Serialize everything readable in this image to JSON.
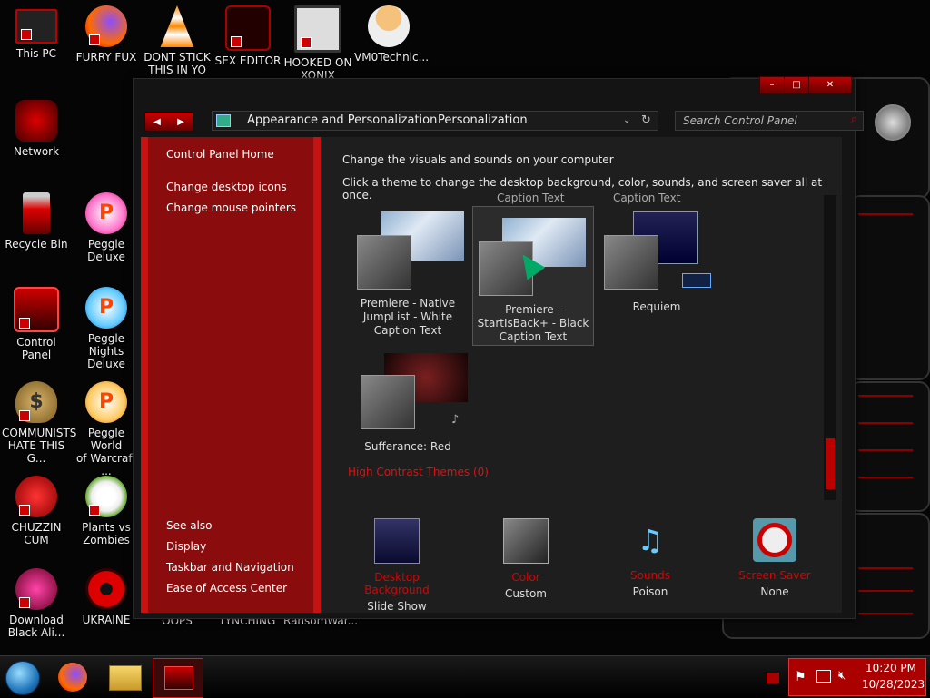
{
  "desktop_icons": [
    {
      "label": "This PC",
      "glyph": "monitor-icon",
      "color": "#b00000"
    },
    {
      "label": "FURRY FUX",
      "glyph": "firefox-icon",
      "color": "#e66000"
    },
    {
      "label": "DONT STICK\nTHIS IN YO",
      "glyph": "vlc-cone-icon",
      "color": "#ff8800"
    },
    {
      "label": "SEX EDITOR",
      "glyph": "editor-icon",
      "color": "#400"
    },
    {
      "label": "HOOKED ON\nXONIX",
      "glyph": "maze-icon",
      "color": "#ddd"
    },
    {
      "label": "VM0Technic...",
      "glyph": "doctor-icon",
      "color": "#f4c27a"
    },
    {
      "label": "Network",
      "glyph": "network-icon",
      "color": "#b00000"
    },
    {
      "label": "Recycle Bin",
      "glyph": "recycle-bin-icon",
      "color": "#cc0000"
    },
    {
      "label": "Peggle Deluxe",
      "glyph": "peggle-icon",
      "color": "#ffb000"
    },
    {
      "label": "Control Panel",
      "glyph": "control-panel-icon",
      "color": "#900"
    },
    {
      "label": "Peggle Nights\nDeluxe",
      "glyph": "peggle-icon",
      "color": "#ffb000"
    },
    {
      "label": "COMMUNISTS\nHATE THIS G...",
      "glyph": "money-bag-icon",
      "color": "#b8934a"
    },
    {
      "label": "Peggle World\nof Warcraft ...",
      "glyph": "peggle-icon",
      "color": "#ffb000"
    },
    {
      "label": "CHUZZIN\nCUM",
      "glyph": "chuzzle-icon",
      "color": "#cc0000"
    },
    {
      "label": "Plants vs\nZombies",
      "glyph": "flower-icon",
      "color": "#e8e8e8"
    },
    {
      "label": "Download\nBlack Ali...",
      "glyph": "alien-sphere-icon",
      "color": "#c02040"
    },
    {
      "label": "UKRAINE",
      "glyph": "radiation-icon",
      "color": "#cc0000"
    },
    {
      "label": "OOPS",
      "glyph": "",
      "color": ""
    },
    {
      "label": "LYNCHING",
      "glyph": "",
      "color": ""
    },
    {
      "label": "RansomWar...",
      "glyph": "",
      "color": ""
    }
  ],
  "window": {
    "nav": {
      "back_symbol": "◀",
      "forward_symbol": "▶",
      "breadcrumb_1": "Appearance and Personalization",
      "breadcrumb_2": "Personalization",
      "search_placeholder": "Search Control Panel"
    },
    "caption_buttons": {
      "minimize": "–",
      "maximize": "□",
      "close": "✕"
    },
    "sidebar": {
      "home": "Control Panel Home",
      "link1": "Change desktop icons",
      "link2": "Change mouse pointers",
      "see_also": "See also",
      "see1": "Display",
      "see2": "Taskbar and Navigation",
      "see3": "Ease of Access Center"
    },
    "main": {
      "heading": "Change the visuals and sounds on your computer",
      "subheading": "Click a theme to change the desktop background, color, sounds, and screen saver all at once.",
      "cutoff_caption_1": "Caption Text",
      "cutoff_caption_2": "Caption Text",
      "themes": [
        {
          "name": "Premiere - Native\nJumpList - White\nCaption Text"
        },
        {
          "name": "Premiere -\nStartIsBack+ - Black\nCaption Text"
        },
        {
          "name": "Requiem"
        },
        {
          "name": "Sufferance: Red"
        }
      ],
      "high_contrast": "High Contrast Themes (0)",
      "bottom": [
        {
          "label": "Desktop Background",
          "value": "Slide Show"
        },
        {
          "label": "Color",
          "value": "Custom"
        },
        {
          "label": "Sounds",
          "value": "Poison"
        },
        {
          "label": "Screen Saver",
          "value": "None"
        }
      ]
    }
  },
  "taskbar": {
    "time": "10:20 PM",
    "date": "10/28/2023"
  },
  "colors": {
    "accent": "#c51212",
    "link_red": "#dd1111"
  }
}
